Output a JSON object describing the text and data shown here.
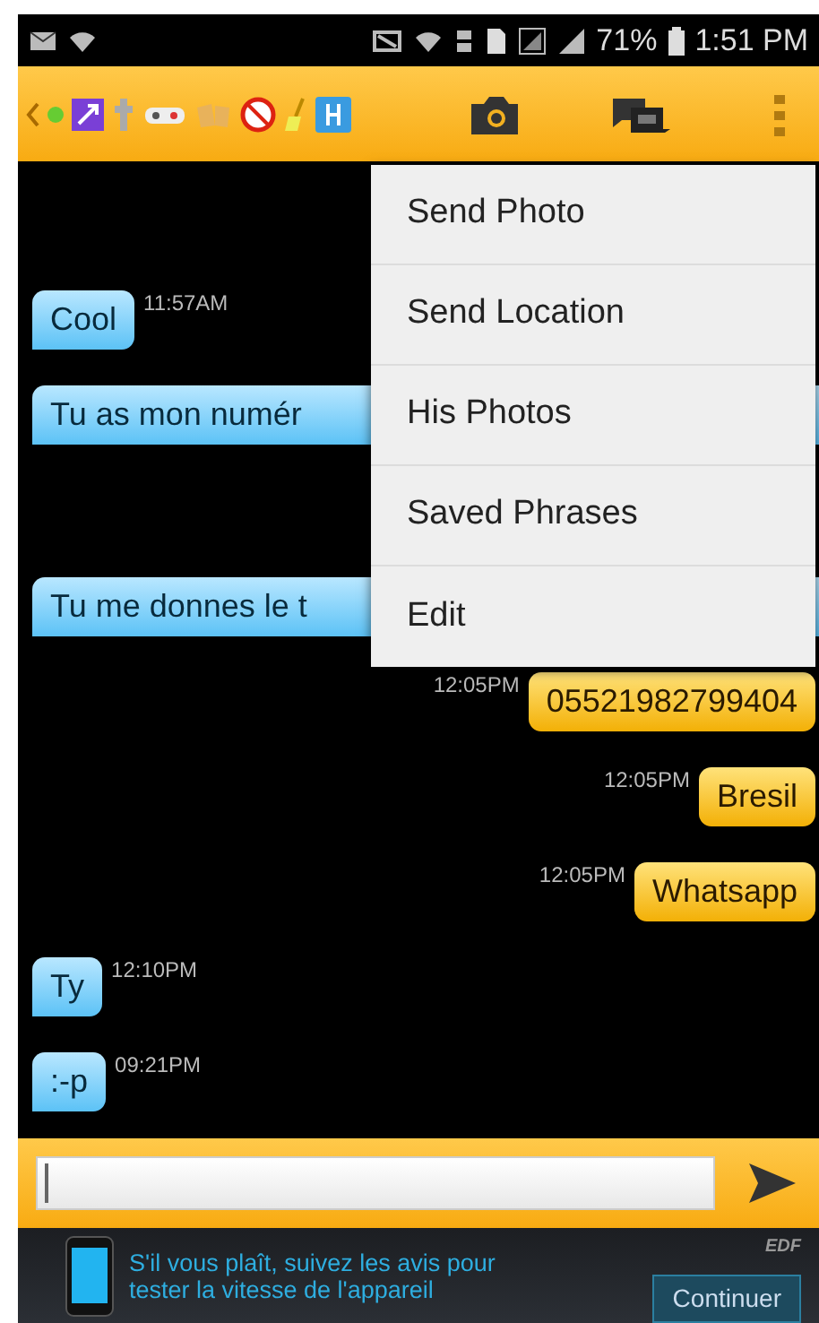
{
  "status_bar": {
    "battery": "71%",
    "time": "1:51 PM"
  },
  "messages": [
    {
      "kind": "incoming",
      "text": "Cool",
      "time": "11:57AM",
      "cut": false
    },
    {
      "kind": "incoming",
      "text": "Tu as mon numér",
      "cut": true
    },
    {
      "kind": "incoming",
      "text": "Tu me donnes le t",
      "cut": true
    },
    {
      "kind": "outgoing",
      "text": "05521982799404",
      "time": "12:05PM",
      "cut": false
    },
    {
      "kind": "outgoing",
      "text": "Bresil",
      "time": "12:05PM",
      "cut": false
    },
    {
      "kind": "outgoing",
      "text": "Whatsapp",
      "time": "12:05PM",
      "cut": false
    },
    {
      "kind": "incoming",
      "text": "Ty",
      "time": "12:10PM",
      "cut": false
    },
    {
      "kind": "incoming",
      "text": ":-p",
      "time": "09:21PM",
      "cut": false
    }
  ],
  "menu": {
    "items": [
      "Send Photo",
      "Send Location",
      "His Photos",
      "Saved Phrases",
      "Edit"
    ]
  },
  "ad": {
    "text": "S'il vous plaît, suivez les avis pour tester la vitesse de l'appareil",
    "brand": "EDF",
    "button": "Continuer"
  }
}
